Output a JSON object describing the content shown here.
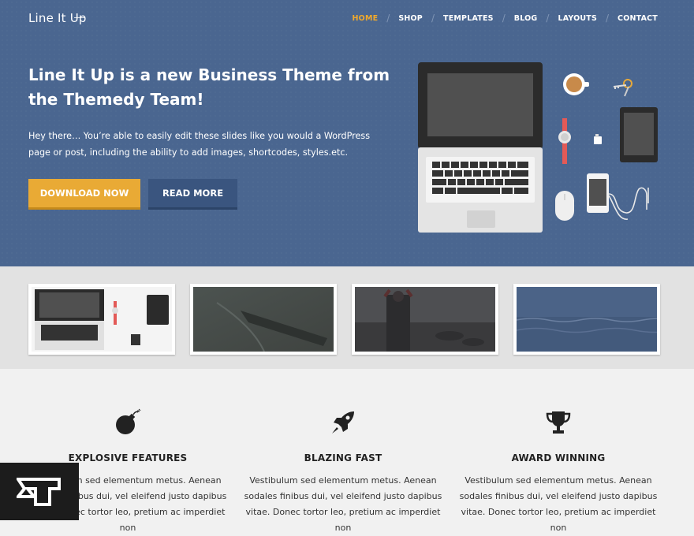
{
  "header": {
    "logo": "Line It Up",
    "nav": [
      {
        "label": "HOME",
        "active": true
      },
      {
        "label": "SHOP",
        "active": false
      },
      {
        "label": "TEMPLATES",
        "active": false
      },
      {
        "label": "BLOG",
        "active": false
      },
      {
        "label": "LAYOUTS",
        "active": false
      },
      {
        "label": "CONTACT",
        "active": false
      }
    ]
  },
  "hero": {
    "headline": "Line It Up is a new Business Theme from the Themedy Team!",
    "subtext": "Hey there… You’re able to easily edit these slides like you would a WordPress page or post, including the ability to add images, shortcodes, styles.etc.",
    "download_label": "DOWNLOAD NOW",
    "readmore_label": "READ MORE"
  },
  "thumbnails": [
    {
      "name": "thumb-devices"
    },
    {
      "name": "thumb-boat"
    },
    {
      "name": "thumb-person-rocks"
    },
    {
      "name": "thumb-ocean"
    }
  ],
  "features": [
    {
      "icon": "bomb-icon",
      "title": "EXPLOSIVE FEATURES",
      "text": "Vestibulum sed elementum metus. Aenean sodales finibus dui, vel eleifend justo dapibus vitae. Donec tortor leo, pretium ac imperdiet non"
    },
    {
      "icon": "rocket-icon",
      "title": "BLAZING FAST",
      "text": "Vestibulum sed elementum metus. Aenean sodales finibus dui, vel eleifend justo dapibus vitae. Donec tortor leo, pretium ac imperdiet non"
    },
    {
      "icon": "trophy-icon",
      "title": "AWARD WINNING",
      "text": "Vestibulum sed elementum metus. Aenean sodales finibus dui, vel eleifend justo dapibus vitae. Donec tortor leo, pretium ac imperdiet non"
    }
  ],
  "colors": {
    "hero_bg": "#4a6690",
    "accent": "#f1a92b",
    "download_button": "#e9aa35",
    "readmore_button": "#3a557f"
  },
  "badge": {
    "icon": "themedy-logo-icon"
  }
}
